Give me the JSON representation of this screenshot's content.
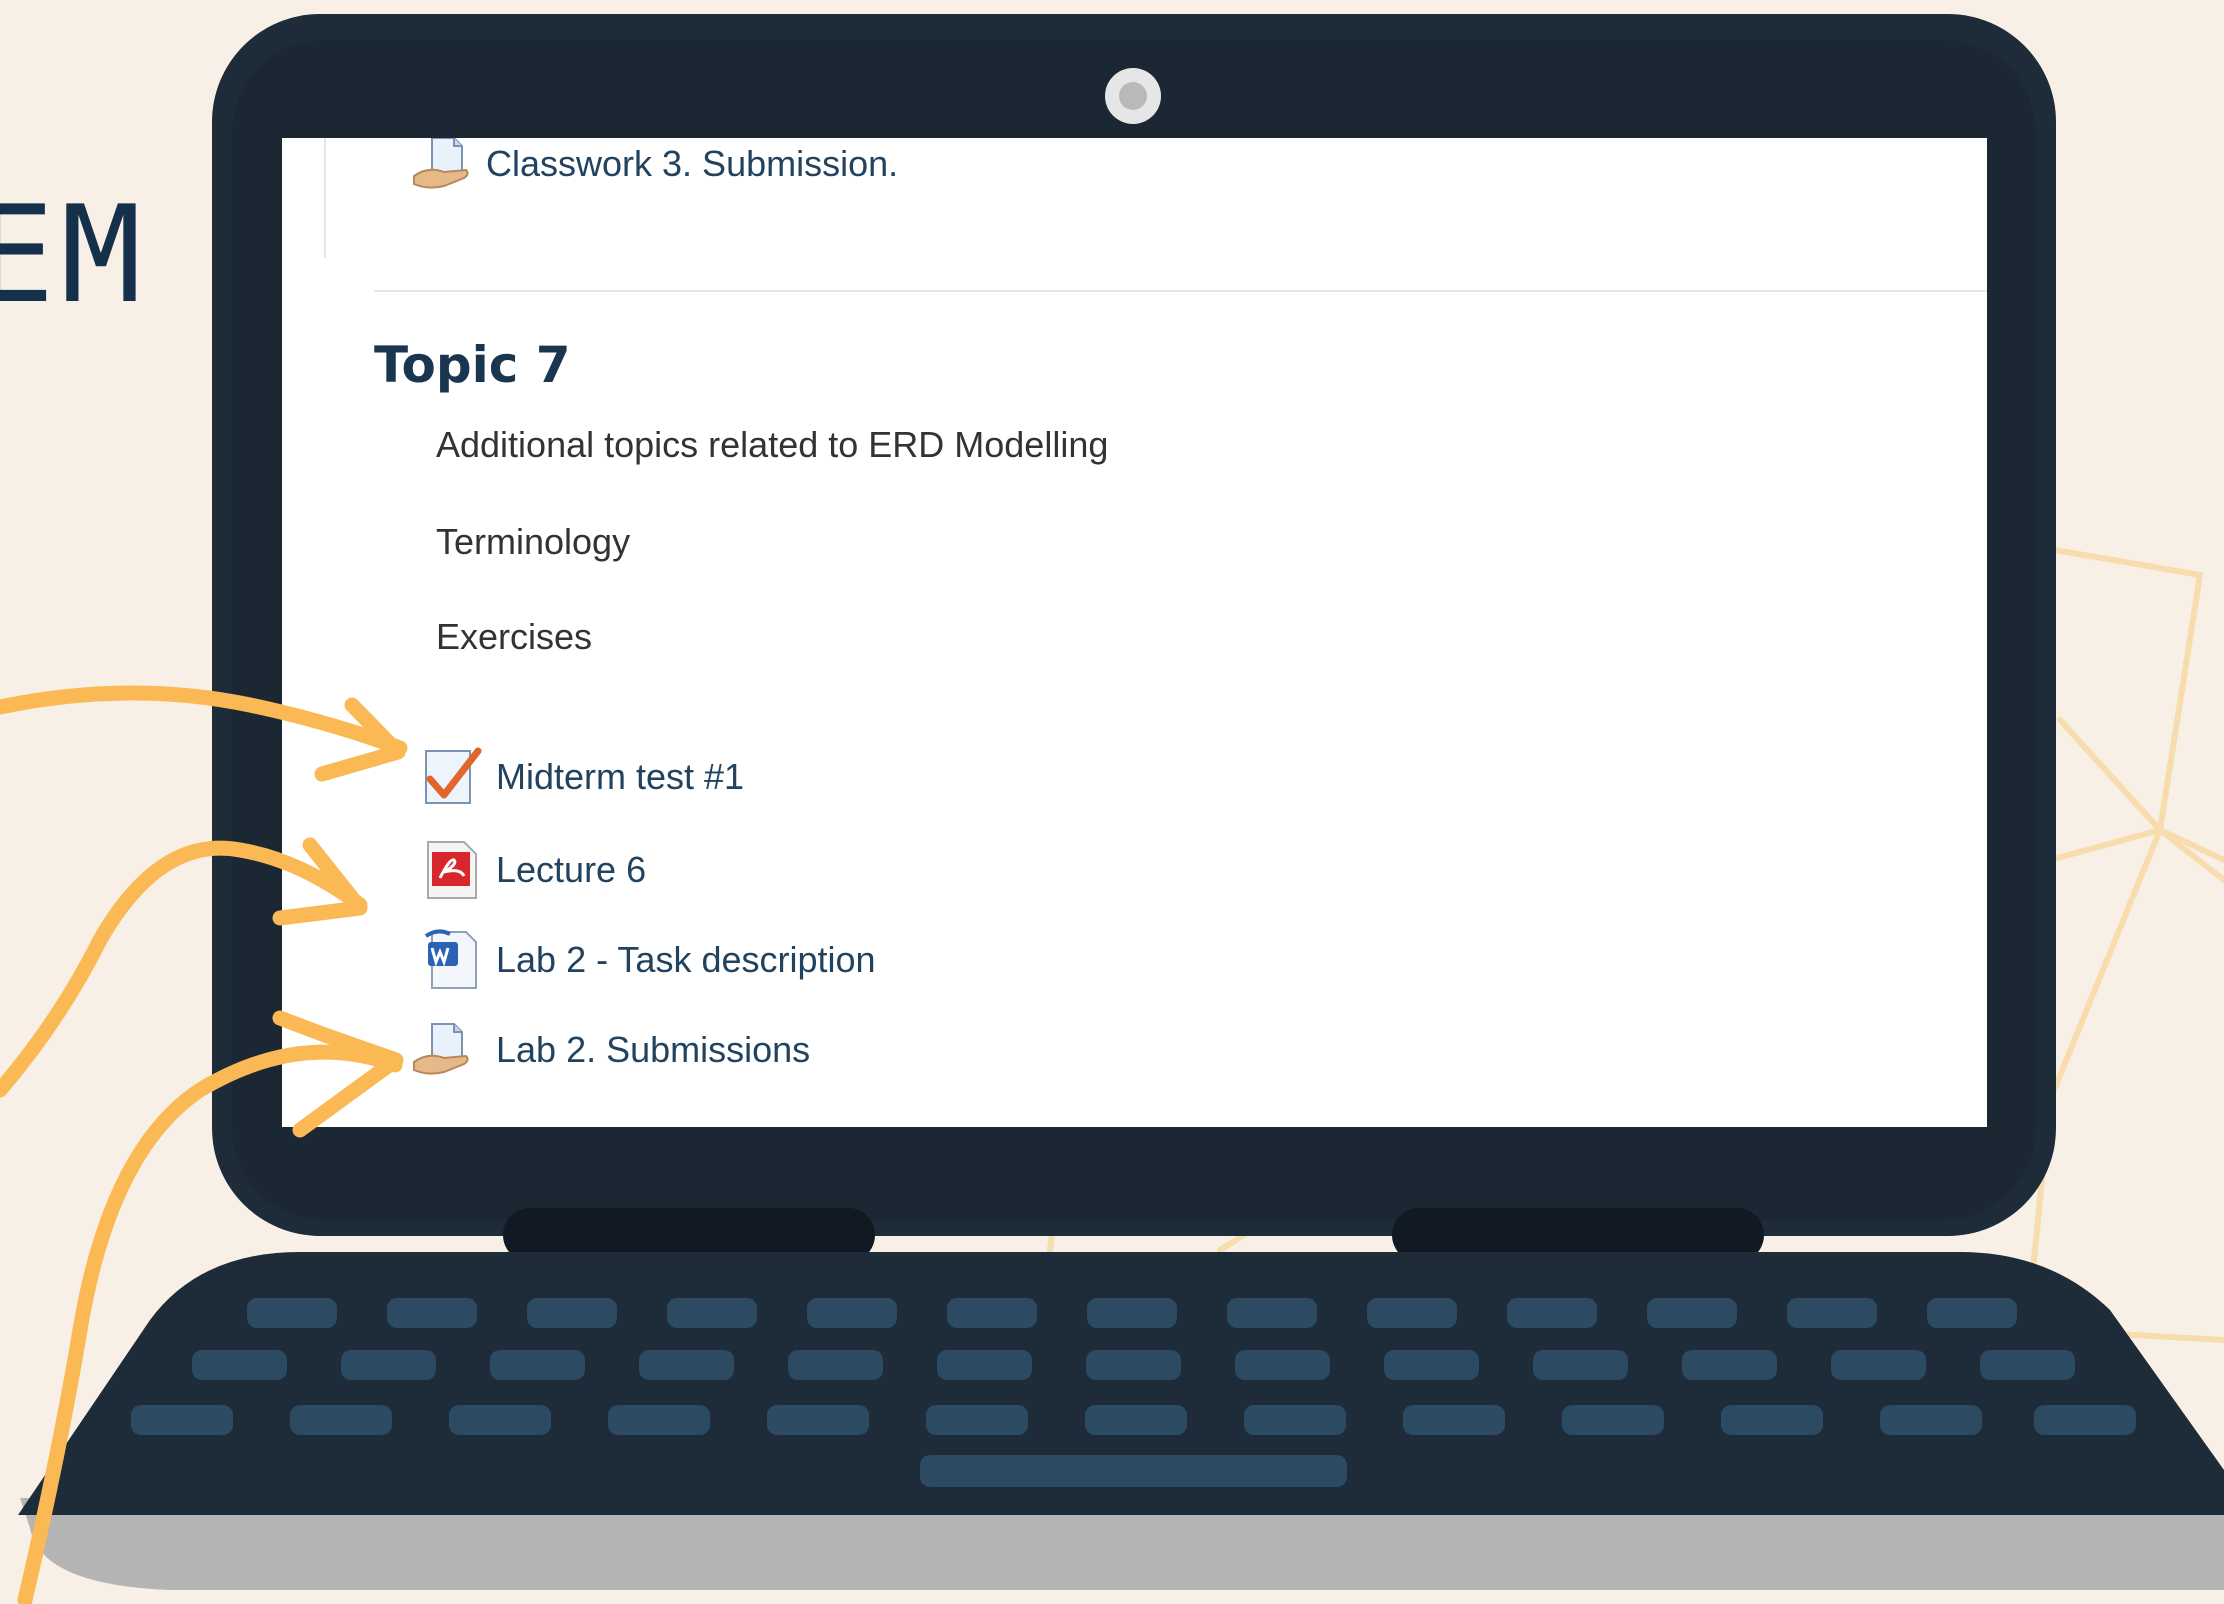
{
  "background": {
    "partial_word": "EM",
    "color": "#f8f0e6",
    "arrow_color": "#fbb955"
  },
  "laptop": {
    "body_color": "#1e2b38",
    "key_color": "#2c4a62",
    "base_color": "#b4b4b4"
  },
  "course_page": {
    "previous_item": {
      "icon": "assignment-hand-icon",
      "label": "Classwork 3. Submission."
    },
    "topic_title": "Topic 7",
    "summary": [
      "Additional topics related to ERD Modelling",
      "Terminology",
      "Exercises"
    ],
    "activities": [
      {
        "icon": "quiz-checkmark-icon",
        "label": "Midterm test #1"
      },
      {
        "icon": "pdf-file-icon",
        "label": "Lecture 6"
      },
      {
        "icon": "word-document-icon",
        "label": "Lab 2 - Task description"
      },
      {
        "icon": "assignment-hand-icon",
        "label": "Lab 2. Submissions"
      }
    ]
  }
}
